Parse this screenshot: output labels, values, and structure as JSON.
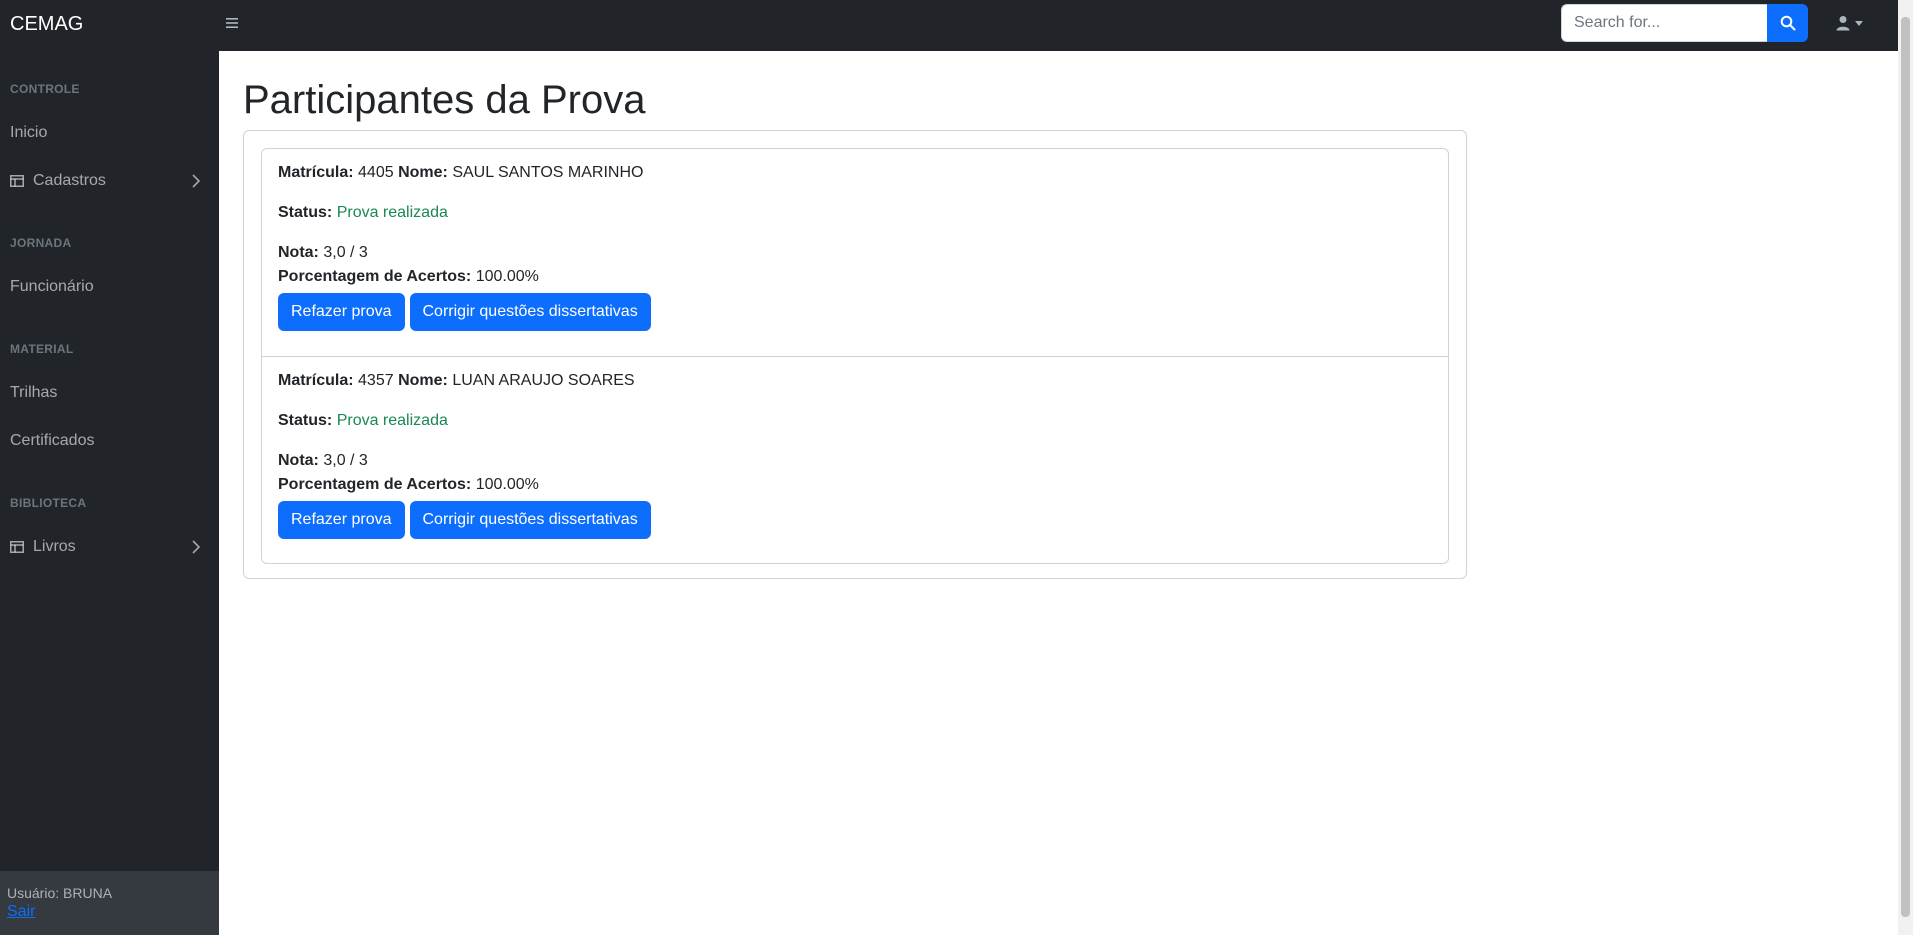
{
  "topbar": {
    "brand": "CEMAG",
    "search_placeholder": "Search for...",
    "icons": {
      "toggle": "bars-icon",
      "search": "search-icon",
      "user": "user-icon"
    }
  },
  "sidebar": {
    "sections": [
      {
        "heading": "CONTROLE",
        "items": [
          {
            "label": "Inicio"
          },
          {
            "label": "Cadastros",
            "icon": "table-icon",
            "expandable": true
          }
        ]
      },
      {
        "heading": "JORNADA",
        "items": [
          {
            "label": "Funcionário"
          }
        ]
      },
      {
        "heading": "MATERIAL",
        "items": [
          {
            "label": "Trilhas"
          },
          {
            "label": "Certificados"
          }
        ]
      },
      {
        "heading": "BIBLIOTECA",
        "items": [
          {
            "label": "Livros",
            "icon": "table-icon",
            "expandable": true
          }
        ]
      }
    ],
    "footer": {
      "user_text": "Usuário: BRUNA",
      "logout_label": "Sair"
    }
  },
  "main": {
    "title": "Participantes da Prova",
    "labels": {
      "matricula": "Matrícula:",
      "nome": "Nome:",
      "status": "Status:",
      "nota": "Nota:",
      "porcentagem": "Porcentagem de Acertos:"
    },
    "participants": [
      {
        "matricula": "4405",
        "nome": "SAUL SANTOS MARINHO",
        "status": "Prova realizada",
        "nota": "3,0 / 3",
        "porcentagem": "100.00%",
        "redo_label": "Refazer prova",
        "grade_label": "Corrigir questões dissertativas"
      },
      {
        "matricula": "4357",
        "nome": "LUAN ARAUJO SOARES",
        "status": "Prova realizada",
        "nota": "3,0 / 3",
        "porcentagem": "100.00%",
        "redo_label": "Refazer prova",
        "grade_label": "Corrigir questões dissertativas"
      }
    ]
  },
  "colors": {
    "sidebar_bg": "#212529",
    "primary": "#0d6efd",
    "success": "#198754"
  }
}
